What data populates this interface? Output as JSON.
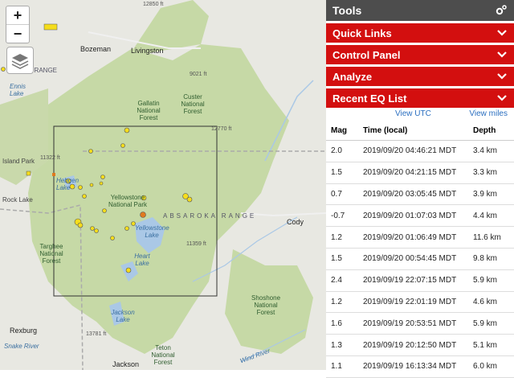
{
  "map": {
    "zoom_in": "+",
    "zoom_out": "−",
    "labels": {
      "bozeman": "Bozeman",
      "livingston": "Livingston",
      "gallatin": "Gallatin National Forest",
      "custer": "Custer National Forest",
      "yellowstone_park": "Yellowstone National Park",
      "yellowstone_lake": "Yellowstone Lake",
      "heart_lake": "Heart Lake",
      "jackson_lake": "Jackson Lake",
      "absaroka": "ABSAROKA RANGE",
      "madison_range": "DISON RANGE",
      "targhee": "Targhee National Forest",
      "teton": "Teton National Forest",
      "shoshone": "Shoshone National Forest",
      "hebgen": "Hebgen Lake",
      "ennis_lake": "Ennis Lake",
      "rock_lake": "Rock Lake",
      "island_park": "Island Park",
      "cody": "Cody",
      "rexburg": "Rexburg",
      "jackson": "Jackson",
      "snake_river": "Snake River",
      "wind_river": "Wind River",
      "elev_9021": "9021 ft",
      "elev_12770": "12770 ft",
      "elev_11322": "11322 ft",
      "elev_11359": "11359 ft",
      "elev_13781": "13781 ft",
      "elev_12850": "12850 ft"
    }
  },
  "panel": {
    "tools_title": "Tools",
    "sections": [
      "Quick Links",
      "Control Panel",
      "Analyze",
      "Recent EQ List"
    ],
    "view_utc": "View UTC",
    "view_miles": "View miles",
    "columns": {
      "mag": "Mag",
      "time": "Time (local)",
      "depth": "Depth"
    },
    "earthquakes": [
      {
        "mag": "2.0",
        "time": "2019/09/20 04:46:21 MDT",
        "depth": "3.4 km"
      },
      {
        "mag": "1.5",
        "time": "2019/09/20 04:21:15 MDT",
        "depth": "3.3 km"
      },
      {
        "mag": "0.7",
        "time": "2019/09/20 03:05:45 MDT",
        "depth": "3.9 km"
      },
      {
        "mag": "-0.7",
        "time": "2019/09/20 01:07:03 MDT",
        "depth": "4.4 km"
      },
      {
        "mag": "1.2",
        "time": "2019/09/20 01:06:49 MDT",
        "depth": "11.6 km"
      },
      {
        "mag": "1.5",
        "time": "2019/09/20 00:54:45 MDT",
        "depth": "9.8 km"
      },
      {
        "mag": "2.4",
        "time": "2019/09/19 22:07:15 MDT",
        "depth": "5.9 km"
      },
      {
        "mag": "1.2",
        "time": "2019/09/19 22:01:19 MDT",
        "depth": "4.6 km"
      },
      {
        "mag": "1.6",
        "time": "2019/09/19 20:53:51 MDT",
        "depth": "5.9 km"
      },
      {
        "mag": "1.3",
        "time": "2019/09/19 20:12:50 MDT",
        "depth": "5.1 km"
      },
      {
        "mag": "1.1",
        "time": "2019/09/19 16:13:34 MDT",
        "depth": "6.0 km"
      }
    ]
  },
  "colors": {
    "accent": "#d30f0f",
    "header": "#4d4d4d",
    "link": "#2b6fc0",
    "quake": "#f5dd1c",
    "quake_recent": "#e07a1f"
  }
}
